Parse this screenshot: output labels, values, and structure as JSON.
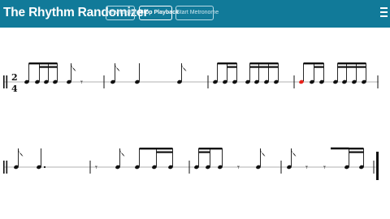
{
  "app": {
    "title": "The Rhythm Randomizer"
  },
  "toolbar": {
    "new_rhythm": "New Rhythm",
    "stop_playback": "Stop Playback",
    "start_metronome": "Start Metronome",
    "menu_icon": "hamburger-menu-icon"
  },
  "score": {
    "time_signature": {
      "top": "2",
      "bottom": "4"
    },
    "playhead_color": "#e8221b"
  },
  "colors": {
    "header": "#117a99",
    "notes": "#111111",
    "highlight": "#e8221b"
  }
}
